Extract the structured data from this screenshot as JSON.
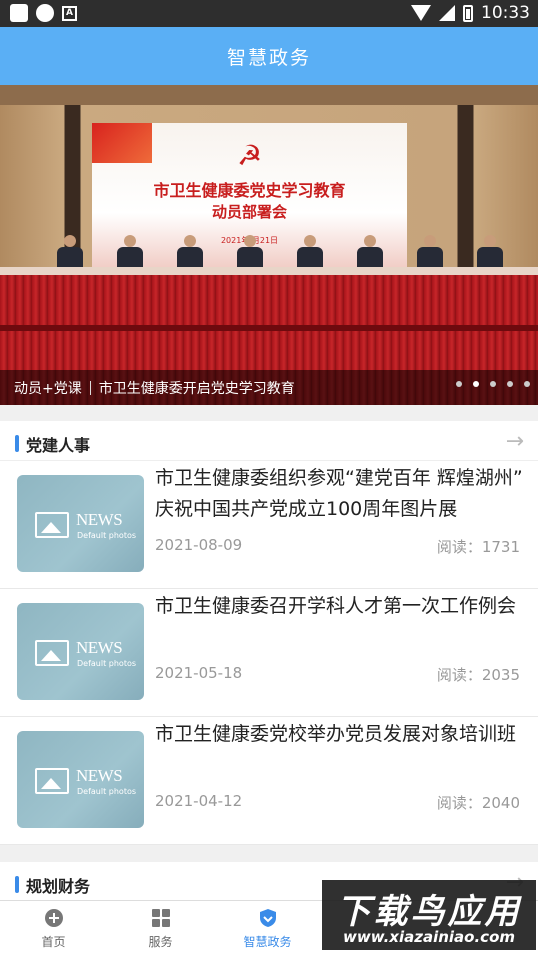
{
  "status_bar": {
    "time": "10:33"
  },
  "header": {
    "title": "智慧政务"
  },
  "banner": {
    "screen_line1": "市卫生健康委党史学习教育",
    "screen_line2": "动员部署会",
    "screen_date": "2021年 月21日",
    "caption_tag": "动员+党课",
    "caption_text": "市卫生健康委开启党史学习教育",
    "dots_total": 5,
    "dots_active_index": 2
  },
  "section_party": {
    "title": "党建人事",
    "items": [
      {
        "title": "市卫生健康委组织参观“建党百年 辉煌湖州” 庆祝中国共产党成立100周年图片展",
        "date": "2021-08-09",
        "reads": "阅读：1731"
      },
      {
        "title": "市卫生健康委召开学科人才第一次工作例会",
        "date": "2021-05-18",
        "reads": "阅读：2035"
      },
      {
        "title": "市卫生健康委党校举办党员发展对象培训班",
        "date": "2021-04-12",
        "reads": "阅读：2040"
      }
    ],
    "thumb_news": "NEWS",
    "thumb_default": "Default photos"
  },
  "section_finance": {
    "title": "规划财务"
  },
  "bottom_nav": {
    "items": [
      {
        "label": "首页"
      },
      {
        "label": "服务"
      },
      {
        "label": "智慧政务"
      }
    ]
  },
  "watermark": {
    "line1": "下载鸟应用",
    "line2": "www.xiazainiao.com"
  },
  "colors": {
    "app_bar": "#5aaff5",
    "accent": "#3a8be8"
  }
}
